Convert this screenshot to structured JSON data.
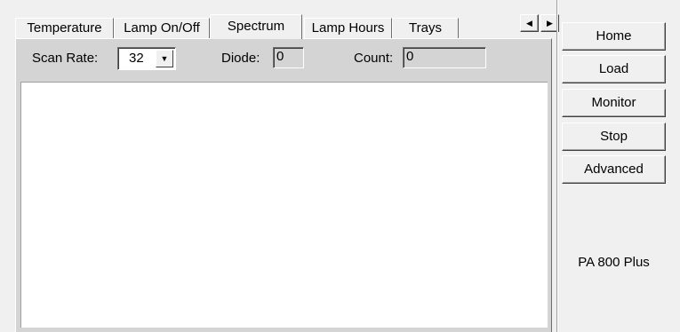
{
  "tabs": [
    {
      "label": "Temperature"
    },
    {
      "label": "Lamp On/Off"
    },
    {
      "label": "Spectrum",
      "active": true
    },
    {
      "label": "Lamp Hours"
    },
    {
      "label": "Trays"
    }
  ],
  "scan": {
    "rate_label": "Scan Rate:",
    "rate_value": "32",
    "diode_label": "Diode:",
    "diode_value": "0",
    "count_label": "Count:",
    "count_value": "0"
  },
  "side_buttons": {
    "home": "Home",
    "load": "Load",
    "monitor": "Monitor",
    "stop": "Stop",
    "advanced": "Advanced"
  },
  "model_name": "PA 800 Plus"
}
